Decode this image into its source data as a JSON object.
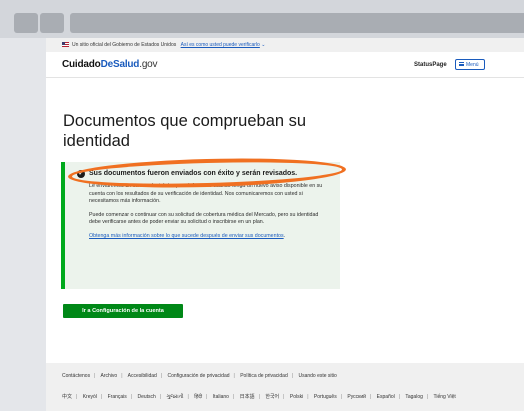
{
  "gov_banner": {
    "text": "Un sitio oficial del Gobierno de Estados Unidos",
    "link": "Así es como usted puede verificarlo"
  },
  "header": {
    "logo_part1": "Cuidado",
    "logo_part2": "DeSalud",
    "logo_part3": ".gov",
    "status_link": "StatusPage",
    "menu_label": "Menú"
  },
  "main": {
    "title": "Documentos que comprueban su identidad",
    "alert": {
      "heading": "Sus documentos fueron enviados con éxito y serán revisados.",
      "paragraph1": "Le enviaremos un correo electrónico para informarle cuando tenga un nuevo aviso disponible en su cuenta con los resultados de su verificación de identidad. Nos comunicaremos con usted si necesitamos más información.",
      "paragraph2": "Puede comenzar o continuar con su solicitud de cobertura médica del Mercado, pero su identidad debe verificarse antes de poder enviar su solicitud o inscribirse en un plan.",
      "link": "Obtenga más información sobre lo que sucede después de enviar sus documentos",
      "link_suffix": "."
    },
    "cta_button": "Ir a Configuración de la cuenta"
  },
  "footer": {
    "links": [
      "Contáctenos",
      "Archivo",
      "Accesibilidad",
      "Configuración de privacidad",
      "Política de privacidad",
      "Usando este sitio"
    ],
    "languages": [
      "中文",
      "Kreyòl",
      "Français",
      "Deutsch",
      "ગુજરાતી",
      "हिंदी",
      "Italiano",
      "日本語",
      "한국어",
      "Polski",
      "Português",
      "Русский",
      "Español",
      "Tagalog",
      "Tiếng Việt"
    ]
  },
  "colors": {
    "accent": "#1a5bbd",
    "success": "#00a91c",
    "button": "#008817",
    "highlight": "#f07021"
  }
}
